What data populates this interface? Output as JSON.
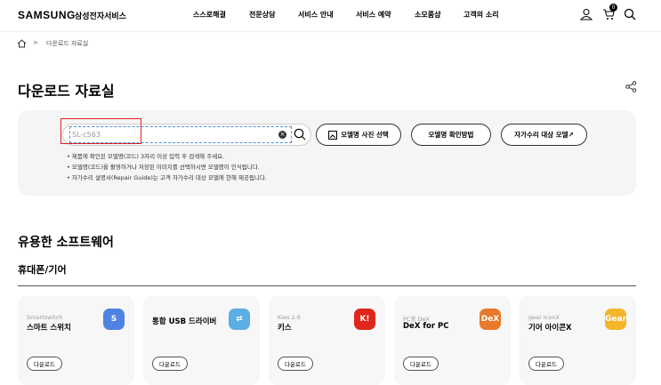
{
  "header": {
    "logo": "SAMSUNG",
    "logo_sub": "삼성전자서비스",
    "nav": [
      "스스로해결",
      "전문상담",
      "서비스 안내",
      "서비스 예약",
      "소모품샵",
      "고객의 소리"
    ],
    "cart_count": "0"
  },
  "breadcrumb": {
    "current": "다운로드 자료실"
  },
  "page_title": "다운로드 자료실",
  "search": {
    "value": "SL-c563",
    "buttons": [
      "모델명 사진 선택",
      "모델명 확인방법",
      "자가수리 대상 모델↗"
    ],
    "notes": [
      "제품에 확인된 모델명(코드) 3자리 이상 입력 후 검색해 주세요.",
      "모델명(코드)을 촬영하거나 저장된 이미지를 선택하시면 모델명이 인식됩니다.",
      "자가수리 설명서(Repair Guide)는 고객 자가수리 대상 모델에 한해 제공됩니다."
    ]
  },
  "software": {
    "title": "유용한 소프트웨어",
    "category": "휴대폰/기어",
    "download_label": "다운로드",
    "items": [
      {
        "sub": "Smartswitch",
        "name": "스마트 스위치",
        "icon": "S",
        "color": "#4f83e3"
      },
      {
        "sub": "",
        "name": "통합 USB 드라이버",
        "icon": "⇄",
        "color": "#5aaee3"
      },
      {
        "sub": "Kies 2.6",
        "name": "키스",
        "icon": "K!",
        "color": "#e0261b"
      },
      {
        "sub": "PC용 DeX",
        "name": "DeX for PC",
        "icon": "DeX",
        "color": "#e8792a"
      },
      {
        "sub": "gear IconX",
        "name": "기어 아이콘X",
        "icon": "Gear",
        "color": "#f5b52a"
      }
    ]
  }
}
